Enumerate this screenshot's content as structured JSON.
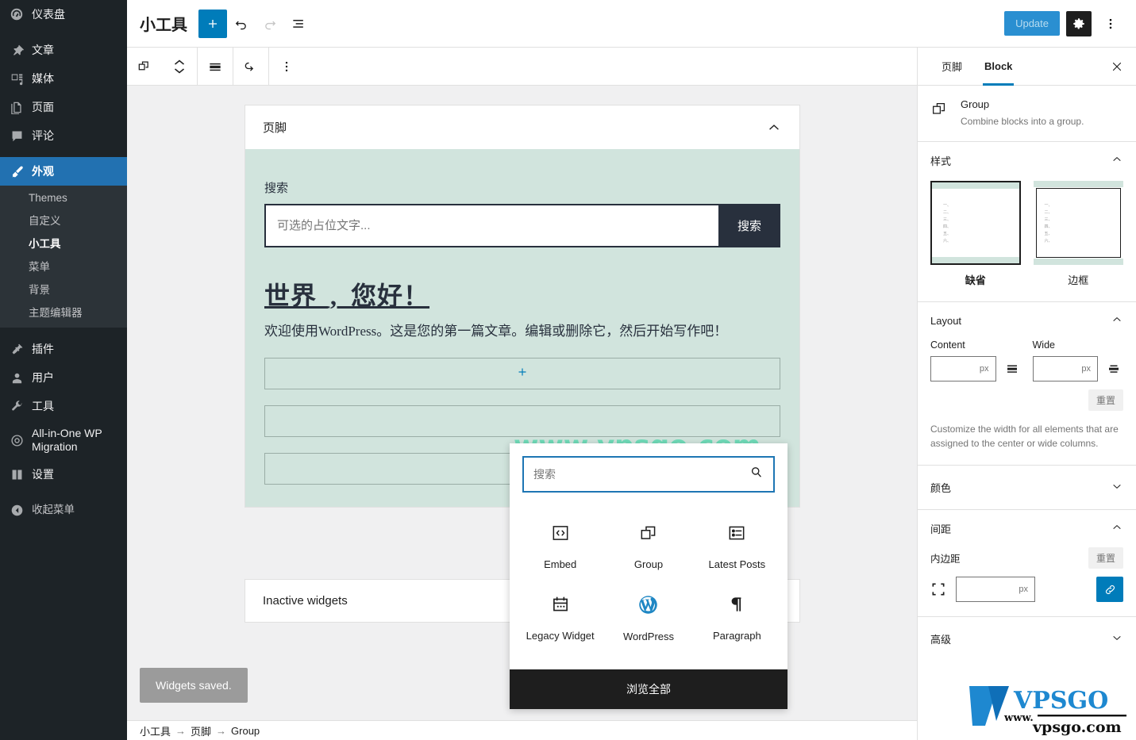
{
  "admin_menu": {
    "items": [
      {
        "label": "仪表盘",
        "icon": "dashboard-icon",
        "current": false
      },
      {
        "label": "文章",
        "icon": "pin-icon",
        "current": false
      },
      {
        "label": "媒体",
        "icon": "media-icon",
        "current": false
      },
      {
        "label": "页面",
        "icon": "page-icon",
        "current": false
      },
      {
        "label": "评论",
        "icon": "comment-icon",
        "current": false
      },
      {
        "label": "外观",
        "icon": "appearance-brush-icon",
        "current": true
      },
      {
        "label": "插件",
        "icon": "plugin-icon",
        "current": false
      },
      {
        "label": "用户",
        "icon": "user-icon",
        "current": false
      },
      {
        "label": "工具",
        "icon": "tools-wrench-icon",
        "current": false
      },
      {
        "label": "All-in-One WP Migration",
        "icon": "migration-icon",
        "current": false
      },
      {
        "label": "设置",
        "icon": "settings-sliders-icon",
        "current": false
      }
    ],
    "submenu": [
      {
        "label": "Themes",
        "current": false
      },
      {
        "label": "自定义",
        "current": false
      },
      {
        "label": "小工具",
        "current": true
      },
      {
        "label": "菜单",
        "current": false
      },
      {
        "label": "背景",
        "current": false
      },
      {
        "label": "主题编辑器",
        "current": false
      }
    ],
    "collapse_label": "收起菜单"
  },
  "header": {
    "title": "小工具",
    "add_block_label": "+",
    "undo_label": "撤销",
    "redo_label": "重做",
    "list_view_label": "列表视图",
    "update_label": "Update",
    "settings_label": "设置",
    "more_label": "选项"
  },
  "block_toolbar": {
    "block_type": "Group",
    "move_up_down": "上移/下移",
    "align": "对齐",
    "transform": "转换",
    "more": "更多选项"
  },
  "canvas": {
    "footer_area": {
      "title": "页脚",
      "search_block": {
        "label": "搜索",
        "placeholder": "可选的占位文字...",
        "button_label": "搜索"
      },
      "heading": "世界_,_您好！",
      "paragraph": "欢迎使用WordPress。这是您的第一篇文章。编辑或删除它，然后开始写作吧！",
      "appender_label": "+"
    },
    "inactive_widgets": {
      "title": "Inactive widgets"
    },
    "snackbar": "Widgets saved.",
    "breadcrumb": [
      "小工具",
      "页脚",
      "Group"
    ],
    "breadcrumb_separator": "→",
    "watermark_text": "www.vpsgo.com"
  },
  "inserter": {
    "search_placeholder": "搜索",
    "search_value": "",
    "search_icon": "search-icon",
    "blocks": [
      {
        "label": "Embed",
        "icon": "embed-code-icon"
      },
      {
        "label": "Group",
        "icon": "group-icon"
      },
      {
        "label": "Latest Posts",
        "icon": "latest-posts-icon"
      },
      {
        "label": "Legacy Widget",
        "icon": "legacy-widget-icon"
      },
      {
        "label": "WordPress",
        "icon": "wordpress-icon"
      },
      {
        "label": "Paragraph",
        "icon": "paragraph-pilcrow-icon"
      }
    ],
    "browse_all_label": "浏览全部"
  },
  "sidebar": {
    "tabs": [
      {
        "label": "页脚",
        "active": false
      },
      {
        "label": "Block",
        "active": true
      }
    ],
    "close_label": "关闭侧边栏",
    "block_card": {
      "name": "Group",
      "description": "Combine blocks into a group.",
      "icon": "group-icon"
    },
    "styles": {
      "title": "样式",
      "collapsed": false,
      "options": [
        {
          "label": "缺省",
          "selected": true
        },
        {
          "label": "边框",
          "selected": false
        }
      ],
      "preview_lines": [
        "一、",
        "二、",
        "三、",
        "四、",
        "五、",
        "六、"
      ]
    },
    "layout": {
      "title": "Layout",
      "collapsed": false,
      "content_label": "Content",
      "content_value": "",
      "content_unit": "px",
      "wide_label": "Wide",
      "wide_value": "",
      "wide_unit": "px",
      "reset_label": "重置",
      "help": "Customize the width for all elements that are assigned to the center or wide columns."
    },
    "colors": {
      "title": "颜色",
      "collapsed": true
    },
    "spacing": {
      "title": "间距",
      "collapsed": false,
      "padding_label": "内边距",
      "padding_value": "",
      "padding_unit": "px",
      "reset_label": "重置",
      "link_sides_label": "链接各边"
    },
    "advanced": {
      "title": "高级",
      "collapsed": true
    }
  },
  "colors": {
    "admin_bg": "#1d2327",
    "admin_submenu_bg": "#2c3338",
    "admin_current": "#2271b1",
    "wp_blue": "#007cba",
    "mint": "#d1e4dd",
    "dark_navy": "#28303d",
    "watermark_green": "#56dab0",
    "logo_blue": "#1e88d0"
  }
}
